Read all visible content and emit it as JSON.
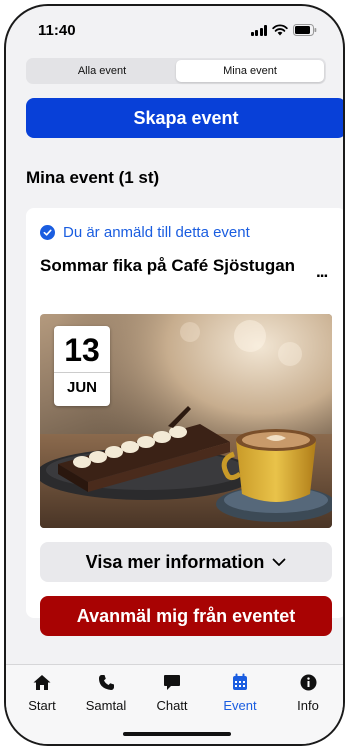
{
  "status_bar": {
    "time": "11:40"
  },
  "segments": [
    {
      "label": "Alla event",
      "active": false
    },
    {
      "label": "Mina event",
      "active": true
    }
  ],
  "create_button": "Skapa event",
  "section_title": "Mina event (1 st)",
  "event": {
    "registered_text": "Du är anmäld till detta event",
    "title": "Sommar fika på Café Sjöstugan",
    "more": "...",
    "date_day": "13",
    "date_month": "JUN",
    "image": "cake-and-coffee-photo",
    "info_button": "Visa mer information",
    "unregister_button": "Avanmäl mig från eventet"
  },
  "tabs": [
    {
      "label": "Start",
      "icon": "home-icon",
      "active": false
    },
    {
      "label": "Samtal",
      "icon": "phone-icon",
      "active": false
    },
    {
      "label": "Chatt",
      "icon": "chat-icon",
      "active": false
    },
    {
      "label": "Event",
      "icon": "calendar-icon",
      "active": true
    },
    {
      "label": "Info",
      "icon": "info-icon",
      "active": false
    }
  ],
  "colors": {
    "accent": "#0840d8",
    "danger": "#a80303",
    "link": "#1a5de0"
  }
}
